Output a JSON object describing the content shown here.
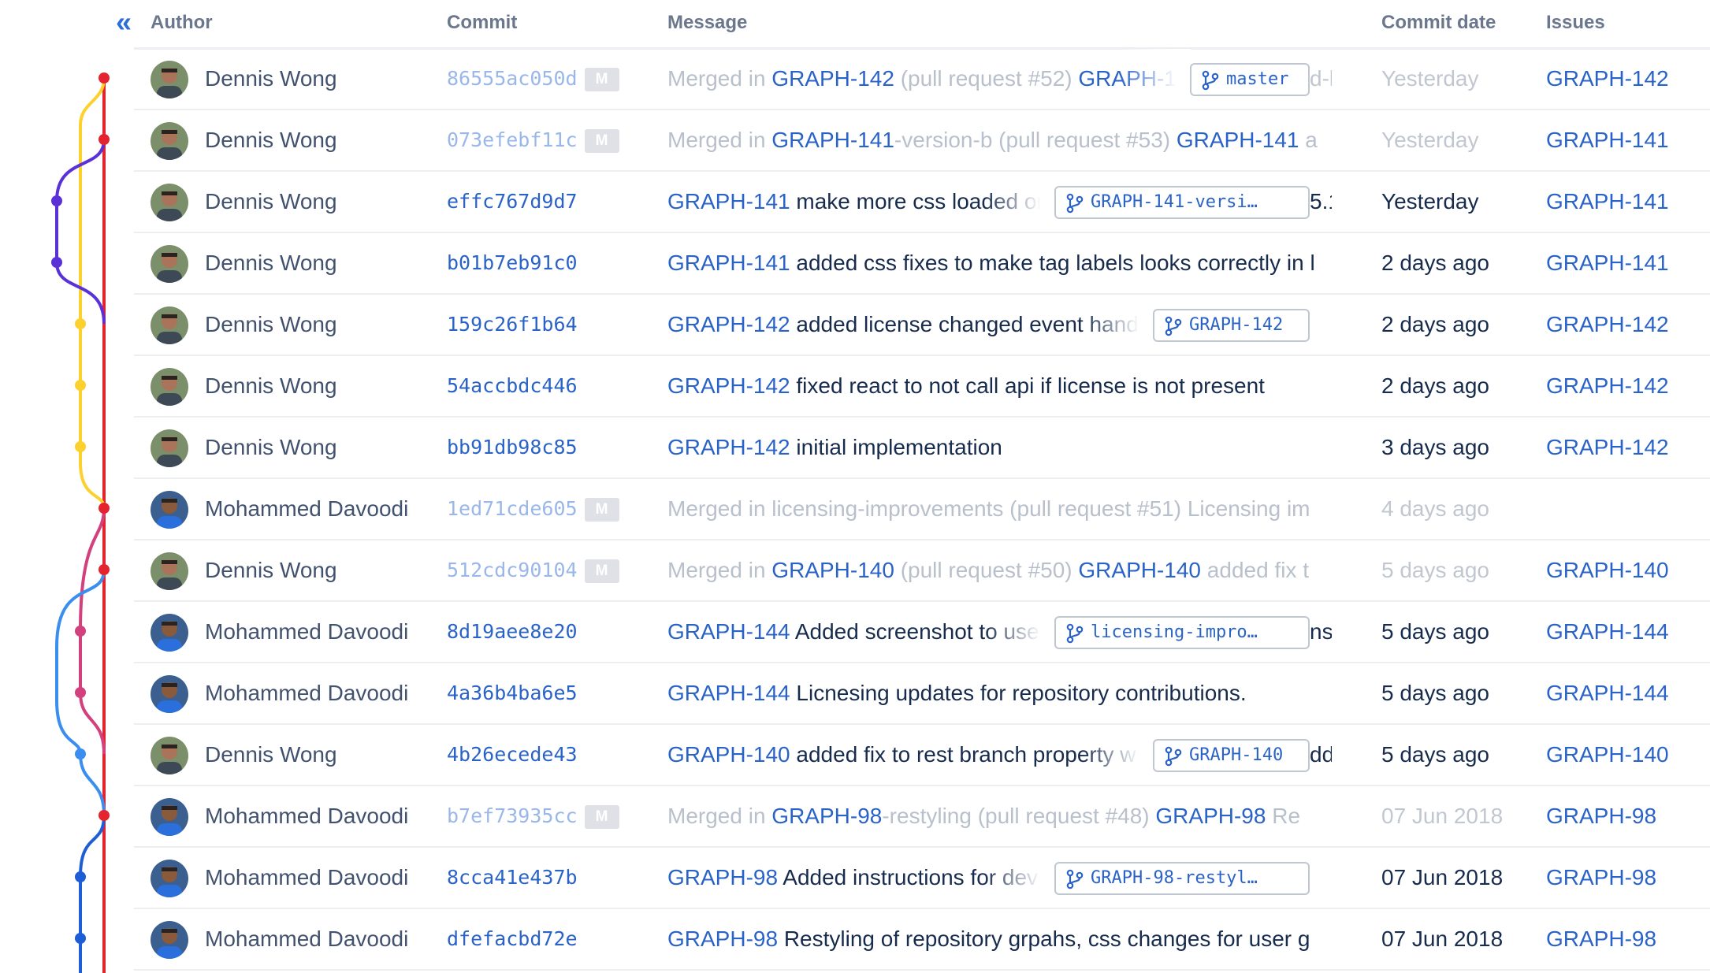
{
  "header": {
    "collapse_icon": "double-chevron-left-icon",
    "collapse_glyph": "«",
    "columns": {
      "author": "Author",
      "commit": "Commit",
      "message": "Message",
      "commit_date": "Commit date",
      "issues": "Issues"
    }
  },
  "colors": {
    "link": "#2a63c7",
    "graph_red": "#e4232e",
    "graph_yellow": "#fcd12e",
    "graph_purple": "#5a31d8",
    "graph_pink": "#d2407d",
    "graph_lightblue": "#3a8ef0",
    "graph_blue": "#1d5ed6"
  },
  "commits": [
    {
      "author": "Dennis Wong",
      "hash": "86555ac050d",
      "merge": true,
      "badge": "M",
      "message": [
        {
          "text": "Merged in ",
          "link": false
        },
        {
          "text": "GRAPH-142",
          "link": true
        },
        {
          "text": " (pull request #52) ",
          "link": false
        },
        {
          "text": "GRAPH-1",
          "link": true
        }
      ],
      "branch": "master",
      "after_branch": "d-l",
      "date": "Yesterday",
      "issue": "GRAPH-142"
    },
    {
      "author": "Dennis Wong",
      "hash": "073efebf11c",
      "merge": true,
      "badge": "M",
      "message": [
        {
          "text": "Merged in ",
          "link": false
        },
        {
          "text": "GRAPH-141",
          "link": true
        },
        {
          "text": "-version-b (pull request #53) ",
          "link": false
        },
        {
          "text": "GRAPH-141",
          "link": true
        },
        {
          "text": " a",
          "link": false
        }
      ],
      "date": "Yesterday",
      "issue": "GRAPH-141"
    },
    {
      "author": "Dennis Wong",
      "hash": "effc767d9d7",
      "merge": false,
      "message": [
        {
          "text": "GRAPH-141",
          "link": true
        },
        {
          "text": " make more css loaded on",
          "link": false
        }
      ],
      "branch": "GRAPH-141-versi…",
      "after_branch": "5.1(",
      "date": "Yesterday",
      "issue": "GRAPH-141"
    },
    {
      "author": "Dennis Wong",
      "hash": "b01b7eb91c0",
      "merge": false,
      "message": [
        {
          "text": "GRAPH-141",
          "link": true
        },
        {
          "text": " added css fixes to make tag labels looks correctly in l",
          "link": false
        }
      ],
      "date": "2 days ago",
      "issue": "GRAPH-141"
    },
    {
      "author": "Dennis Wong",
      "hash": "159c26f1b64",
      "merge": false,
      "message": [
        {
          "text": "GRAPH-142",
          "link": true
        },
        {
          "text": " added license changed event hand",
          "link": false
        }
      ],
      "branch": "GRAPH-142",
      "date": "2 days ago",
      "issue": "GRAPH-142"
    },
    {
      "author": "Dennis Wong",
      "hash": "54accbdc446",
      "merge": false,
      "message": [
        {
          "text": "GRAPH-142",
          "link": true
        },
        {
          "text": " fixed react to not call api if license is not present",
          "link": false
        }
      ],
      "date": "2 days ago",
      "issue": "GRAPH-142"
    },
    {
      "author": "Dennis Wong",
      "hash": "bb91db98c85",
      "merge": false,
      "message": [
        {
          "text": "GRAPH-142",
          "link": true
        },
        {
          "text": " initial implementation",
          "link": false
        }
      ],
      "date": "3 days ago",
      "issue": "GRAPH-142"
    },
    {
      "author": "Mohammed Davoodi",
      "hash": "1ed71cde605",
      "merge": true,
      "badge": "M",
      "message": [
        {
          "text": "Merged in licensing-improvements (pull request #51) Licensing im",
          "link": false
        }
      ],
      "date": "4 days ago",
      "issue": ""
    },
    {
      "author": "Dennis Wong",
      "hash": "512cdc90104",
      "merge": true,
      "badge": "M",
      "message": [
        {
          "text": "Merged in ",
          "link": false
        },
        {
          "text": "GRAPH-140",
          "link": true
        },
        {
          "text": " (pull request #50) ",
          "link": false
        },
        {
          "text": "GRAPH-140",
          "link": true
        },
        {
          "text": " added fix t",
          "link": false
        }
      ],
      "date": "5 days ago",
      "issue": "GRAPH-140"
    },
    {
      "author": "Mohammed Davoodi",
      "hash": "8d19aee8e20",
      "merge": false,
      "message": [
        {
          "text": "GRAPH-144",
          "link": true
        },
        {
          "text": " Added screenshot to use",
          "link": false
        }
      ],
      "branch": "licensing-impro…",
      "after_branch": "nsi",
      "date": "5 days ago",
      "issue": "GRAPH-144"
    },
    {
      "author": "Mohammed Davoodi",
      "hash": "4a36b4ba6e5",
      "merge": false,
      "message": [
        {
          "text": "GRAPH-144",
          "link": true
        },
        {
          "text": " Licnesing updates for repository contributions.",
          "link": false
        }
      ],
      "date": "5 days ago",
      "issue": "GRAPH-144"
    },
    {
      "author": "Dennis Wong",
      "hash": "4b26ecede43",
      "merge": false,
      "message": [
        {
          "text": "GRAPH-140",
          "link": true
        },
        {
          "text": " added fix to rest branch property w",
          "link": false
        }
      ],
      "branch": "GRAPH-140",
      "after_branch": "dd",
      "date": "5 days ago",
      "issue": "GRAPH-140"
    },
    {
      "author": "Mohammed Davoodi",
      "hash": "b7ef73935cc",
      "merge": true,
      "badge": "M",
      "message": [
        {
          "text": "Merged in ",
          "link": false
        },
        {
          "text": "GRAPH-98",
          "link": true
        },
        {
          "text": "-restyling (pull request #48) ",
          "link": false
        },
        {
          "text": "GRAPH-98",
          "link": true
        },
        {
          "text": " Re",
          "link": false
        }
      ],
      "date": "07 Jun 2018",
      "issue": "GRAPH-98"
    },
    {
      "author": "Mohammed Davoodi",
      "hash": "8cca41e437b",
      "merge": false,
      "message": [
        {
          "text": "GRAPH-98",
          "link": true
        },
        {
          "text": " Added instructions for dev",
          "link": false
        }
      ],
      "branch": "GRAPH-98-restyl…",
      "date": "07 Jun 2018",
      "issue": "GRAPH-98"
    },
    {
      "author": "Mohammed Davoodi",
      "hash": "dfefacbd72e",
      "merge": false,
      "message": [
        {
          "text": "GRAPH-98",
          "link": true
        },
        {
          "text": " Restyling of repository grpahs, css changes for user g",
          "link": false
        }
      ],
      "date": "07 Jun 2018",
      "issue": "GRAPH-98"
    }
  ]
}
